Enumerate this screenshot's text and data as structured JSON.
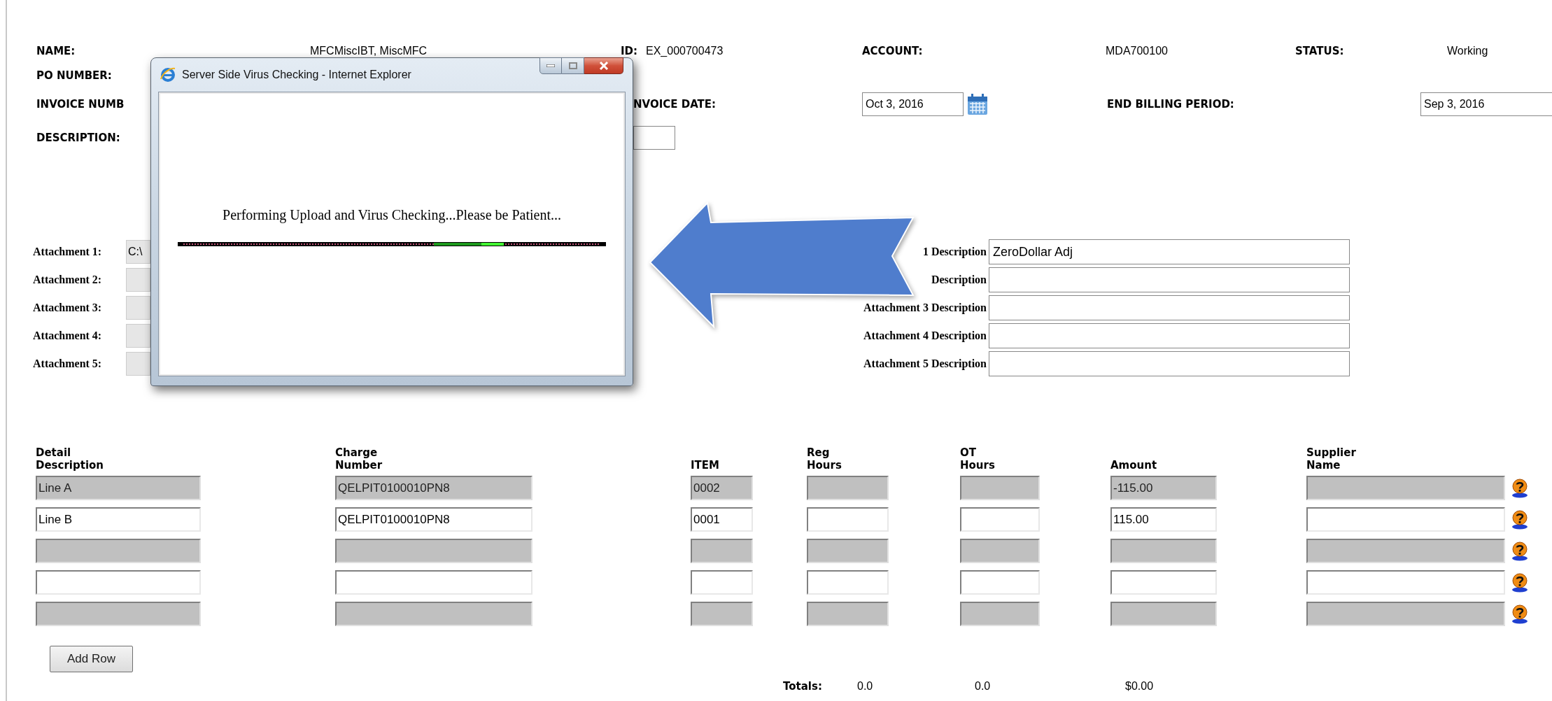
{
  "header_rows": [
    [
      {
        "kind": "label",
        "text": "NAME:"
      },
      {
        "kind": "value",
        "text": "MFCMiscIBT, MiscMFC"
      },
      {
        "kind": "label",
        "text": "ID:"
      },
      {
        "kind": "value",
        "text": "EX_000700473"
      },
      {
        "kind": "label",
        "text": "ACCOUNT:"
      },
      {
        "kind": "value",
        "text": "MDA700100"
      },
      {
        "kind": "label",
        "text": "STATUS:"
      },
      {
        "kind": "value",
        "text": "Working"
      }
    ],
    [
      {
        "kind": "label",
        "text": "PO NUMBER:"
      }
    ],
    [
      {
        "kind": "label",
        "text": "INVOICE NUMB"
      },
      {
        "kind": "label",
        "text": "NVOICE DATE:"
      },
      {
        "kind": "date",
        "value": "Oct 3, 2016"
      },
      {
        "kind": "label",
        "text": "END BILLING PERIOD:"
      },
      {
        "kind": "field",
        "value": "Sep 3, 2016"
      }
    ],
    [
      {
        "kind": "label",
        "text": "DESCRIPTION:"
      },
      {
        "kind": "field"
      }
    ]
  ],
  "attachments": [
    {
      "label": "Attachment 1:",
      "value": "C:\\",
      "description_label": "1 Description",
      "description": "ZeroDollar Adj"
    },
    {
      "label": "Attachment 2:",
      "description_label": "Description"
    },
    {
      "label": "Attachment 3:",
      "description_label": "Attachment 3 Description"
    },
    {
      "label": "Attachment 4:",
      "description_label": "Attachment 4 Description"
    },
    {
      "label": "Attachment 5:",
      "description_label": "Attachment 5 Description"
    }
  ],
  "table": {
    "columns": [
      {
        "header": "Detail Description"
      },
      {
        "header": "Charge Number"
      },
      {
        "header": "ITEM"
      },
      {
        "header": "Reg Hours"
      },
      {
        "header": "OT Hours"
      },
      {
        "header": "Amount"
      },
      {
        "header": "Supplier Name"
      }
    ],
    "rows": [
      {
        "disabled": true,
        "cells": [
          {
            "text": "Line A"
          },
          {
            "text": "QELPIT0100010PN8"
          },
          {
            "text": "0002"
          },
          {},
          {},
          {
            "text": "-115.00"
          },
          {}
        ]
      },
      {
        "disabled": false,
        "cells": [
          {
            "text": "Line B"
          },
          {
            "text": "QELPIT0100010PN8"
          },
          {
            "text": "0001"
          },
          {},
          {},
          {
            "text": "115.00"
          },
          {}
        ]
      },
      {
        "disabled": true,
        "cells": [
          {},
          {},
          {},
          {},
          {},
          {},
          {}
        ]
      },
      {
        "disabled": false,
        "cells": [
          {},
          {},
          {},
          {},
          {},
          {},
          {}
        ]
      },
      {
        "disabled": true,
        "cells": [
          {},
          {},
          {},
          {},
          {},
          {},
          {}
        ]
      }
    ]
  },
  "add_row_button": "Add Row",
  "totals": {
    "label": "Totals:",
    "reg": "0.0",
    "ot": "0.0",
    "amount": "$0.00"
  },
  "popup": {
    "title": "Server Side Virus Checking - Internet Explorer",
    "message": "Performing Upload and Virus Checking...Please be Patient..."
  }
}
